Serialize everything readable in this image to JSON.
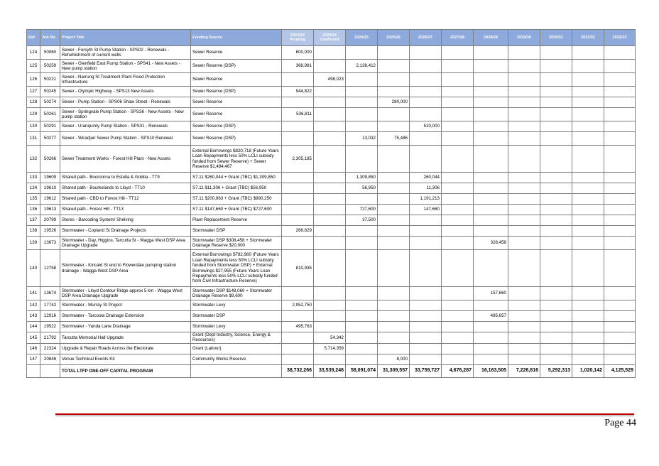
{
  "table": {
    "headers": {
      "ref": "Ref",
      "job_no": "Job No.",
      "project_title": "Project Title",
      "funding_source": "Funding Source",
      "y2324p_a": "2023/24",
      "y2324p_b": "Pending",
      "y2324c_a": "2023/24",
      "y2324c_b": "Confirmed",
      "y2425": "2024/25",
      "y2526": "2025/26",
      "y2627": "2026/27",
      "y2728": "2027/28",
      "y2829": "2028/29",
      "y2930": "2029/30",
      "y3031": "2030/31",
      "y3132": "2031/32",
      "y3233": "2032/33"
    },
    "rows": [
      {
        "ref": "124",
        "job": "50060",
        "title": "Sewer - Forsyth St Pump Station - SPS02 - Renewals - Refurbishment of current wells",
        "funding": "Sewer Reserve",
        "pending": "600,000",
        "confirmed": "",
        "y2425": "",
        "y2526": "",
        "y2627": "",
        "y2728": "",
        "y2829": "",
        "y2930": "",
        "y3031": "",
        "y3132": "",
        "y3233": ""
      },
      {
        "ref": "125",
        "job": "50259",
        "title": "Sewer - Glenfield East Pump Station - SPS41 - New Assets - New pump station",
        "funding": "Sewer Reserve (DSP)",
        "pending": "368,981",
        "confirmed": "",
        "y2425": "2,138,412",
        "y2526": "",
        "y2627": "",
        "y2728": "",
        "y2829": "",
        "y2930": "",
        "y3031": "",
        "y3132": "",
        "y3233": ""
      },
      {
        "ref": "126",
        "job": "50221",
        "title": "Sewer - Narrung St Treatment Plant Flood Protection Infrastructure",
        "funding": "Sewer Reserve",
        "pending": "",
        "confirmed": "498,023",
        "y2425": "",
        "y2526": "",
        "y2627": "",
        "y2728": "",
        "y2829": "",
        "y2930": "",
        "y3031": "",
        "y3132": "",
        "y3233": ""
      },
      {
        "ref": "127",
        "job": "50245",
        "title": "Sewer - Olympic Highway - SPS13 New Assets",
        "funding": "Sewer Reserve (DSP)",
        "pending": "944,822",
        "confirmed": "",
        "y2425": "",
        "y2526": "",
        "y2627": "",
        "y2728": "",
        "y2829": "",
        "y2930": "",
        "y3031": "",
        "y3132": "",
        "y3233": ""
      },
      {
        "ref": "128",
        "job": "50274",
        "title": "Sewer - Pump Station - SPS06 Shaw Street - Renewals",
        "funding": "Sewer Reserve",
        "pending": "",
        "confirmed": "",
        "y2425": "",
        "y2526": "280,000",
        "y2627": "",
        "y2728": "",
        "y2829": "",
        "y2930": "",
        "y3031": "",
        "y3132": "",
        "y3233": ""
      },
      {
        "ref": "129",
        "job": "50261",
        "title": "Sewer - Springvale Pump Station - SPS36 - New Assets - New pump station",
        "funding": "Sewer Reserve",
        "pending": "536,811",
        "confirmed": "",
        "y2425": "",
        "y2526": "",
        "y2627": "",
        "y2728": "",
        "y2829": "",
        "y2930": "",
        "y3031": "",
        "y3132": "",
        "y3233": ""
      },
      {
        "ref": "130",
        "job": "50291",
        "title": "Sewer - Uranquinty Pump Station - SPS31 - Renewals",
        "funding": "Sewer Reserve (DSP)",
        "pending": "",
        "confirmed": "",
        "y2425": "",
        "y2526": "",
        "y2627": "520,000",
        "y2728": "",
        "y2829": "",
        "y2930": "",
        "y3031": "",
        "y3132": "",
        "y3233": ""
      },
      {
        "ref": "131",
        "job": "50277",
        "title": "Sewer - Wiradjuri Sewer Pump Station - SPS10 Renewal",
        "funding": "Sewer Reserve (DSP)",
        "pending": "",
        "confirmed": "",
        "y2425": "13,032",
        "y2526": "75,486",
        "y2627": "",
        "y2728": "",
        "y2829": "",
        "y2930": "",
        "y3031": "",
        "y3132": "",
        "y3233": ""
      },
      {
        "ref": "132",
        "job": "50266",
        "title": "Sewer Treatment Works - Forest Hill Plant - New Assets",
        "funding": "External Borrowings $820,718 (Future Years Loan Repayments less 50% LCLI subsidy funded from Sewer Reserve) + Sewer Reserve $1,484,467",
        "pending": "2,305,185",
        "confirmed": "",
        "y2425": "",
        "y2526": "",
        "y2627": "",
        "y2728": "",
        "y2829": "",
        "y2930": "",
        "y3031": "",
        "y3132": "",
        "y3233": ""
      },
      {
        "ref": "133",
        "job": "19609",
        "title": "Shared path - Booroorna to Estella & Gobba - TT9",
        "funding": "S7.11 $260,044 + Grant (TBC) $1,309,850",
        "pending": "",
        "confirmed": "",
        "y2425": "1,309,850",
        "y2526": "",
        "y2627": "260,044",
        "y2728": "",
        "y2829": "",
        "y2930": "",
        "y3031": "",
        "y3132": "",
        "y3233": ""
      },
      {
        "ref": "134",
        "job": "19610",
        "title": "Shared path - Bourkelands to Lloyd - TT10",
        "funding": "S7.11 $11,306 + Grant (TBC) $56,950",
        "pending": "",
        "confirmed": "",
        "y2425": "56,950",
        "y2526": "",
        "y2627": "11,306",
        "y2728": "",
        "y2829": "",
        "y2930": "",
        "y3031": "",
        "y3132": "",
        "y3233": ""
      },
      {
        "ref": "135",
        "job": "19612",
        "title": "Shared path - CBD to Forest Hill - TT12",
        "funding": "S7.11 $200,963 + Grant (TBC) $990,250",
        "pending": "",
        "confirmed": "",
        "y2425": "",
        "y2526": "",
        "y2627": "1,191,213",
        "y2728": "",
        "y2829": "",
        "y2930": "",
        "y3031": "",
        "y3132": "",
        "y3233": ""
      },
      {
        "ref": "136",
        "job": "19613",
        "title": "Shared path - Forest Hill - TT13",
        "funding": "S7.11 $147,660 + Grant (TBC) $727,600",
        "pending": "",
        "confirmed": "",
        "y2425": "727,600",
        "y2526": "",
        "y2627": "147,660",
        "y2728": "",
        "y2829": "",
        "y2930": "",
        "y3031": "",
        "y3132": "",
        "y3233": ""
      },
      {
        "ref": "137",
        "job": "20799",
        "title": "Stores - Barcoding System/ Shelving",
        "funding": "Plant Replacement Reserve",
        "pending": "",
        "confirmed": "",
        "y2425": "37,500",
        "y2526": "",
        "y2627": "",
        "y2728": "",
        "y2829": "",
        "y2930": "",
        "y3031": "",
        "y3132": "",
        "y3233": ""
      },
      {
        "ref": "138",
        "job": "19526",
        "title": "Stormwater - Copland St Drainage Projects",
        "funding": "Stormwater DSP",
        "pending": "266,829",
        "confirmed": "",
        "y2425": "",
        "y2526": "",
        "y2627": "",
        "y2728": "",
        "y2829": "",
        "y2930": "",
        "y3031": "",
        "y3132": "",
        "y3233": ""
      },
      {
        "ref": "139",
        "job": "13673",
        "title": "Stormwater - Day, Higgins, Tarcutta St - Wagga West DSP Area Drainage Upgrade",
        "funding": "Stormwater DSP $308,458 + Stormwater Drainage Reserve $20,000",
        "pending": "",
        "confirmed": "",
        "y2425": "",
        "y2526": "",
        "y2627": "",
        "y2728": "",
        "y2829": "328,458",
        "y2930": "",
        "y3031": "",
        "y3132": "",
        "y3233": ""
      },
      {
        "ref": "140",
        "job": "12758",
        "title": "Stormwater - Kincaid St end to Flowerdale pumping station drainage - Wagga West DSP Area",
        "funding": "External Borrowings $782,980 (Future Years Loan Repayments less 50% LCLI subsidy funded from Stormwater DSP) + External Borrowings $27,955 (Future Years Loan Repayments less 50% LCLI subsidy funded from Civil Infrastructure Reserve)",
        "pending": "810,935",
        "confirmed": "",
        "y2425": "",
        "y2526": "",
        "y2627": "",
        "y2728": "",
        "y2829": "",
        "y2930": "",
        "y3031": "",
        "y3132": "",
        "y3233": ""
      },
      {
        "ref": "141",
        "job": "13674",
        "title": "Stormwater - Lloyd Contour Ridge approx 5 km - Wagga West DSP Area Drainage Upgrade",
        "funding": "Stormwater DSP $148,060 + Stormwater Drainage Reserve $9,600",
        "pending": "",
        "confirmed": "",
        "y2425": "",
        "y2526": "",
        "y2627": "",
        "y2728": "",
        "y2829": "157,660",
        "y2930": "",
        "y3031": "",
        "y3132": "",
        "y3233": ""
      },
      {
        "ref": "142",
        "job": "17742",
        "title": "Stormwater - Murray St Project",
        "funding": "Stormwater Levy",
        "pending": "2,952,750",
        "confirmed": "",
        "y2425": "",
        "y2526": "",
        "y2627": "",
        "y2728": "",
        "y2829": "",
        "y2930": "",
        "y3031": "",
        "y3132": "",
        "y3233": ""
      },
      {
        "ref": "143",
        "job": "12916",
        "title": "Stormwater - Tarcoola Drainage Extension",
        "funding": "Stormwater DSP",
        "pending": "",
        "confirmed": "",
        "y2425": "",
        "y2526": "",
        "y2627": "",
        "y2728": "",
        "y2829": "495,657",
        "y2930": "",
        "y3031": "",
        "y3132": "",
        "y3233": ""
      },
      {
        "ref": "144",
        "job": "19522",
        "title": "Stormwater - Yanda Lane Drainage",
        "funding": "Stormwater Levy",
        "pending": "495,763",
        "confirmed": "",
        "y2425": "",
        "y2526": "",
        "y2627": "",
        "y2728": "",
        "y2829": "",
        "y2930": "",
        "y3031": "",
        "y3132": "",
        "y3233": ""
      },
      {
        "ref": "145",
        "job": "21792",
        "title": "Tarcutta Memorial Hall Upgrade",
        "funding": "Grant (Dept Industry, Science, Energy & Resources)",
        "pending": "",
        "confirmed": "54,342",
        "y2425": "",
        "y2526": "",
        "y2627": "",
        "y2728": "",
        "y2829": "",
        "y2930": "",
        "y3031": "",
        "y3132": "",
        "y3233": ""
      },
      {
        "ref": "146",
        "job": "22324",
        "title": "Upgrade & Repair Roads Across the Electorate",
        "funding": "Grant (Labour)",
        "pending": "",
        "confirmed": "5,714,359",
        "y2425": "",
        "y2526": "",
        "y2627": "",
        "y2728": "",
        "y2829": "",
        "y2930": "",
        "y3031": "",
        "y3132": "",
        "y3233": ""
      },
      {
        "ref": "147",
        "job": "20846",
        "title": "Venue Technical Events Kit",
        "funding": "Community Works Reserve",
        "pending": "",
        "confirmed": "",
        "y2425": "",
        "y2526": "8,000",
        "y2627": "",
        "y2728": "",
        "y2829": "",
        "y2930": "",
        "y3031": "",
        "y3132": "",
        "y3233": ""
      }
    ],
    "total": {
      "label": "TOTAL LTFP ONE-OFF CAPITAL PROGRAM",
      "pending": "38,732,266",
      "confirmed": "33,539,246",
      "y2425": "58,091,074",
      "y2526": "31,309,557",
      "y2627": "33,759,727",
      "y2728": "4,676,287",
      "y2829": "16,163,505",
      "y2930": "7,226,816",
      "y3031": "5,292,313",
      "y3132": "1,020,142",
      "y3233": "4,125,529"
    }
  },
  "footer": {
    "page_label": "Page 44"
  },
  "colors": {
    "header_bg": "#8ea9db",
    "header_highlight_bg": "#b4c6e7",
    "rule_red": "#c00000",
    "grid": "#7f7f7f"
  }
}
